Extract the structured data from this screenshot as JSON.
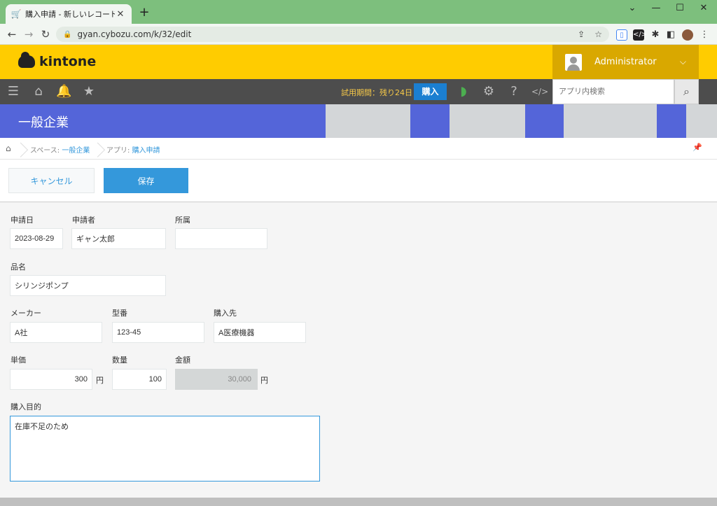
{
  "browser": {
    "tab_title": "購入申請 - 新しいレコード",
    "tab_close": "✕",
    "new_tab": "+",
    "url": "gyan.cybozu.com/k/32/edit",
    "win_min": "—",
    "win_max": "☐",
    "win_close": "✕"
  },
  "header": {
    "logo": "kintone",
    "user": "Administrator"
  },
  "toolbar": {
    "trial": "試用期間：残り24日",
    "buy": "購入",
    "search_placeholder": "アプリ内検索"
  },
  "space": {
    "title": "一般企業"
  },
  "breadcrumb": {
    "space_prefix": "スペース: ",
    "space_link": "一般企業",
    "app_prefix": "アプリ: ",
    "app_link": "購入申請"
  },
  "actions": {
    "cancel": "キャンセル",
    "save": "保存"
  },
  "form": {
    "date_label": "申請日",
    "date_value": "2023-08-29",
    "applicant_label": "申請者",
    "applicant_value": "ギャン太郎",
    "dept_label": "所属",
    "dept_value": "",
    "product_label": "品名",
    "product_value": "シリンジポンプ",
    "maker_label": "メーカー",
    "maker_value": "A社",
    "model_label": "型番",
    "model_value": "123-45",
    "vendor_label": "購入先",
    "vendor_value": "A医療機器",
    "price_label": "単価",
    "price_value": "300",
    "price_unit": "円",
    "qty_label": "数量",
    "qty_value": "100",
    "amount_label": "金額",
    "amount_value": "30,000",
    "amount_unit": "円",
    "purpose_label": "購入目的",
    "purpose_value": "在庫不足のため"
  },
  "colors": {
    "header_yellow": "#ffcc00",
    "accent_blue": "#3498db",
    "banner_blue": "#5465d9"
  }
}
